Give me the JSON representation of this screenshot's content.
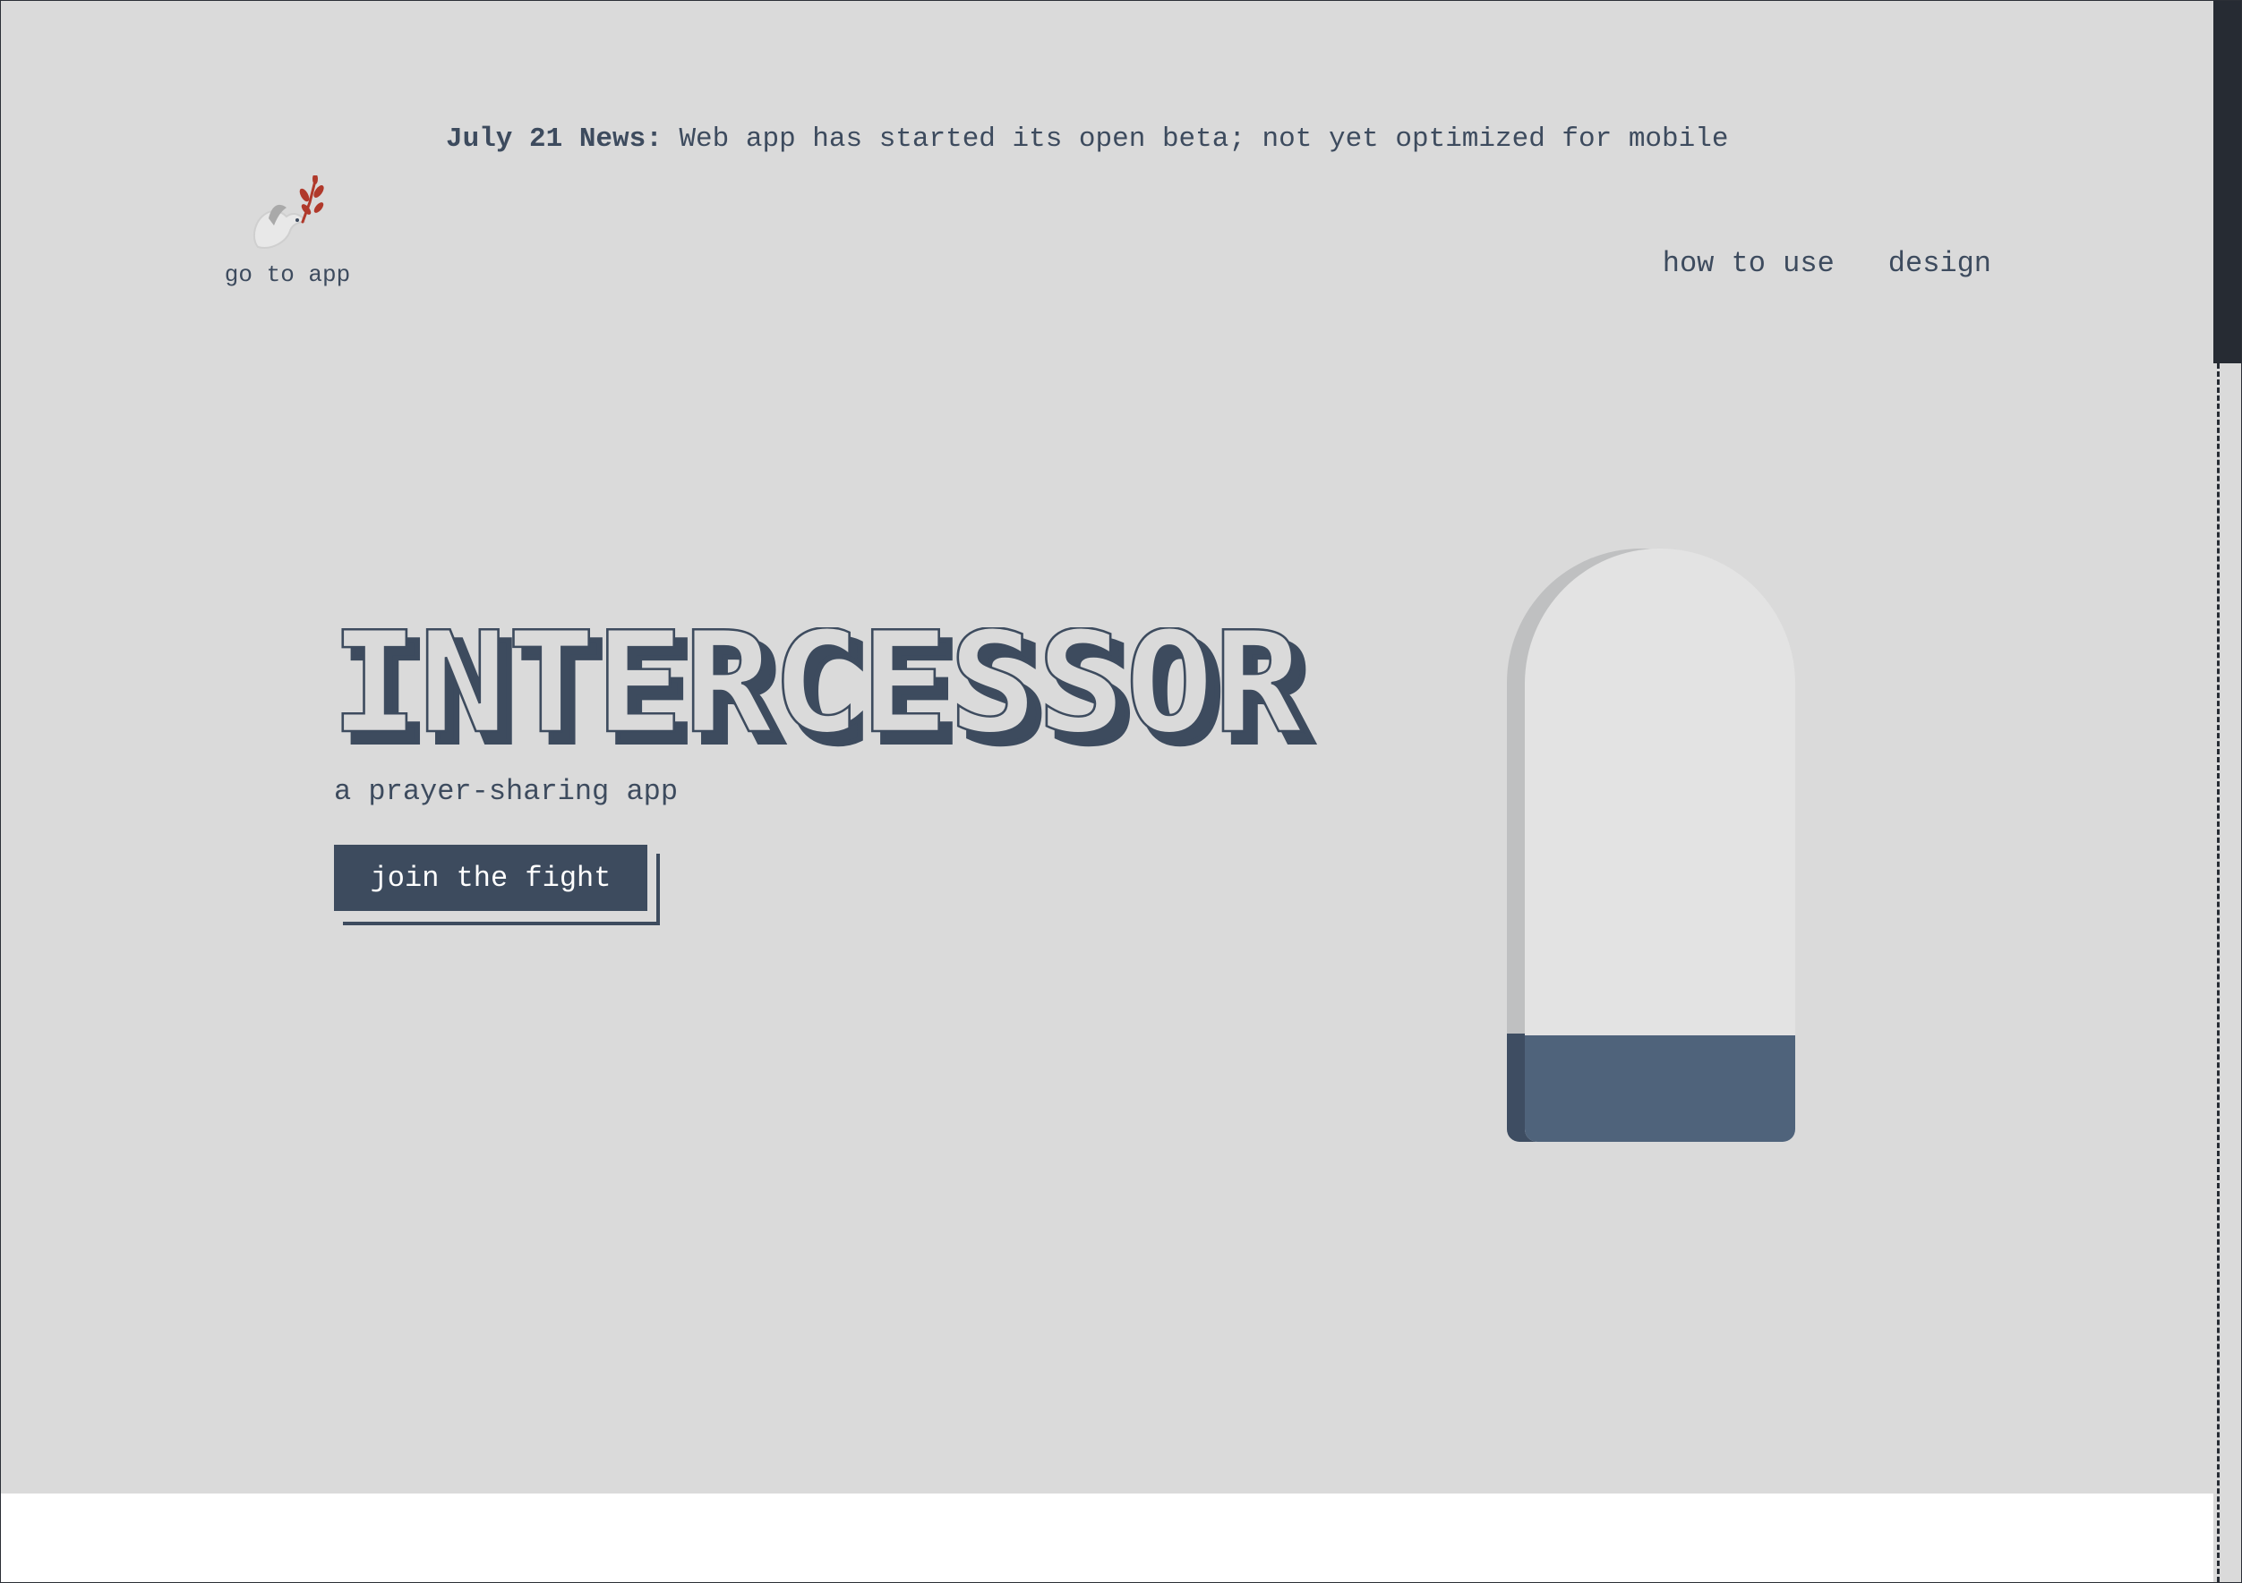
{
  "news": {
    "label": "July 21 News:",
    "text": "Web app has started its open beta; not yet optimized for mobile"
  },
  "logo": {
    "icon": "dove-with-olive-branch-icon",
    "link_label": "go to app"
  },
  "nav": {
    "items": [
      {
        "label": "how to use"
      },
      {
        "label": "design"
      }
    ]
  },
  "hero": {
    "title": "INTERCESSOR",
    "subtitle": "a prayer-sharing app",
    "cta_label": "join the fight"
  },
  "pillar": {
    "fill_fraction": 0.18
  },
  "colors": {
    "background": "#dadada",
    "primary": "#3d4b5e",
    "pillar_fill": "#4f637b",
    "pillar_body": "#e3e3e3",
    "olive_branch": "#b0392b"
  }
}
